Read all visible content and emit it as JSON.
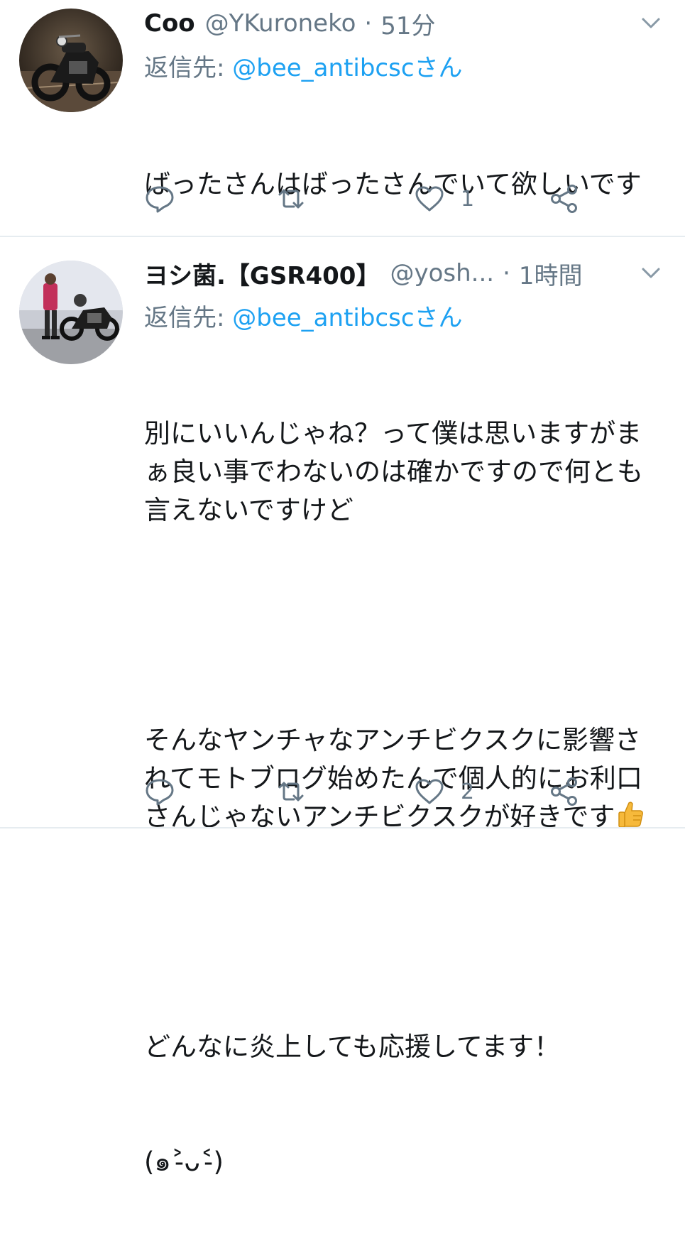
{
  "tweets": [
    {
      "display_name": "Coo",
      "handle": "@YKuroneko",
      "separator": "·",
      "time": "51分",
      "reply_prefix": "返信先: ",
      "reply_mention": "@bee_antibcscさん",
      "lines": [
        "ばったさんはばったさんでいて欲しいです"
      ],
      "reply_count": "",
      "retweet_count": "",
      "like_count": "1",
      "icons": {
        "avatar": "motorcycle-night-avatar",
        "menu": "chevron-down-icon",
        "reply": "reply-icon",
        "retweet": "retweet-icon",
        "like": "heart-icon",
        "share": "share-icon"
      }
    },
    {
      "display_name": "ヨシ菌.【GSR400】",
      "handle": "@yosh...",
      "separator": "·",
      "time": "1時間",
      "reply_prefix": "返信先: ",
      "reply_mention": "@bee_antibcscさん",
      "para1": "別にいいんじゃね？って僕は思いますがまぁ良い事でわないのは確かですので何とも言えないですけど",
      "para2": "そんなヤンチャなアンチビクスクに影響されてモトブログ始めたんで個人的にお利口さんじゃないアンチビクスクが好きです",
      "emoji": "thumbs-up-emoji",
      "para3": "どんなに炎上しても応援してます！",
      "para4": "(๑˃̵ᴗ˂̵)",
      "reply_count": "",
      "retweet_count": "",
      "like_count": "2",
      "icons": {
        "avatar": "rider-with-motorcycle-avatar",
        "menu": "chevron-down-icon",
        "reply": "reply-icon",
        "retweet": "retweet-icon",
        "like": "heart-icon",
        "share": "share-icon"
      }
    }
  ],
  "colors": {
    "text": "#14171a",
    "secondary": "#657786",
    "link": "#1da1f2",
    "divider": "#e6ecf0"
  }
}
